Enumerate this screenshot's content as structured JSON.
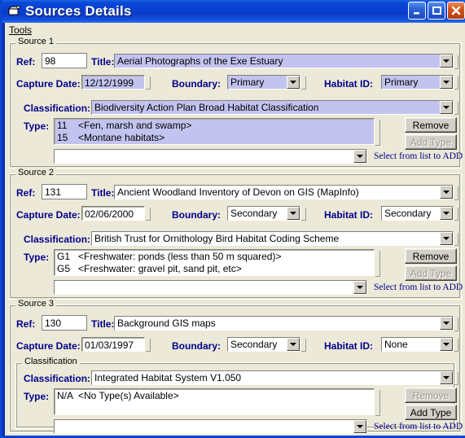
{
  "window": {
    "title": "Sources Details",
    "icon": "database-window-icon",
    "buttons": {
      "minimize": "minimize-icon",
      "maximize": "maximize-icon",
      "close": "close-icon"
    }
  },
  "menu": {
    "items": [
      {
        "label": "Tools"
      }
    ]
  },
  "labels": {
    "ref": "Ref:",
    "title": "Title:",
    "capture_date": "Capture Date:",
    "boundary": "Boundary:",
    "habitat_id": "Habitat ID:",
    "classification": "Classification:",
    "type": "Type:",
    "remove": "Remove",
    "add_type": "Add Type",
    "hint": "Select from list to ADD",
    "classification_group": "Classification"
  },
  "colors": {
    "titlebar_blue": "#0a3fd0",
    "label_blue": "#00008b",
    "selection_lavender": "#c3c3f0",
    "form_background": "#ece9d8",
    "close_orange": "#d2561f"
  },
  "sources": [
    {
      "legend": "Source 1",
      "ref": "98",
      "title": "Aerial Photographs of the Exe Estuary",
      "capture_date": "12/12/1999",
      "boundary": "Primary",
      "habitat_id": "Primary",
      "classification": "Biodiversity Action Plan Broad Habitat Classification",
      "types": [
        {
          "code": "11",
          "desc": "<Fen, marsh and swamp>"
        },
        {
          "code": "15",
          "desc": "<Montane habitats>"
        }
      ],
      "add_combo_value": "",
      "remove_enabled": true,
      "add_type_enabled": false,
      "highlighted": true,
      "nested_classification_group": false
    },
    {
      "legend": "Source 2",
      "ref": "131",
      "title": "Ancient Woodland Inventory of Devon on GIS (MapInfo)",
      "capture_date": "02/06/2000",
      "boundary": "Secondary",
      "habitat_id": "Secondary",
      "classification": "British Trust for Ornithology Bird Habitat Coding Scheme",
      "types": [
        {
          "code": "G1",
          "desc": "<Freshwater: ponds (less than 50 m squared)>"
        },
        {
          "code": "G5",
          "desc": "<Freshwater: gravel pit, sand pit, etc>"
        }
      ],
      "add_combo_value": "",
      "remove_enabled": true,
      "add_type_enabled": false,
      "highlighted": false,
      "nested_classification_group": false
    },
    {
      "legend": "Source 3",
      "ref": "130",
      "title": "Background GIS maps",
      "capture_date": "01/03/1997",
      "boundary": "Secondary",
      "habitat_id": "None",
      "classification": "Integrated Habitat System V1.050",
      "types": [
        {
          "code": "N/A",
          "desc": "<No Type(s) Available>"
        }
      ],
      "add_combo_value": "",
      "remove_enabled": false,
      "add_type_enabled": true,
      "highlighted": false,
      "nested_classification_group": true
    }
  ]
}
